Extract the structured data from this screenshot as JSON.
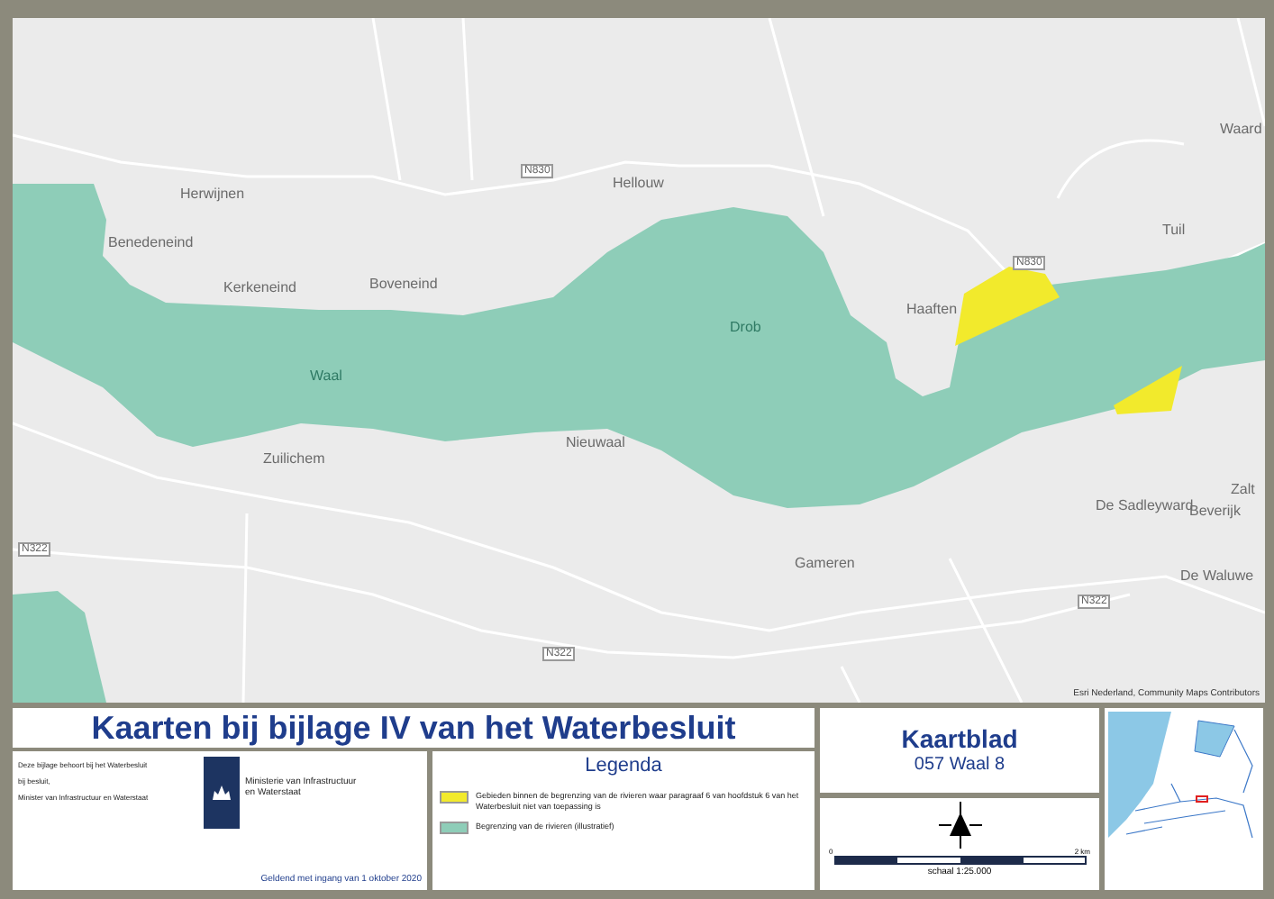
{
  "map": {
    "labels": [
      {
        "text": "Herwijnen",
        "kind": "place"
      },
      {
        "text": "Benedeneind",
        "kind": "place"
      },
      {
        "text": "Kerkeneind",
        "kind": "place"
      },
      {
        "text": "Boveneind",
        "kind": "place"
      },
      {
        "text": "N830",
        "kind": "road"
      },
      {
        "text": "Hellouw",
        "kind": "place"
      },
      {
        "text": "Waal",
        "kind": "water"
      },
      {
        "text": "Nieuwaal",
        "kind": "place"
      },
      {
        "text": "Zuilichem",
        "kind": "place"
      },
      {
        "text": "N322",
        "kind": "road"
      },
      {
        "text": "N322",
        "kind": "road"
      },
      {
        "text": "Drob",
        "kind": "water"
      },
      {
        "text": "Haaften",
        "kind": "place"
      },
      {
        "text": "N830",
        "kind": "road"
      },
      {
        "text": "Tuil",
        "kind": "place"
      },
      {
        "text": "Waard",
        "kind": "place"
      },
      {
        "text": "Gameren",
        "kind": "place"
      },
      {
        "text": "De Sadleyward",
        "kind": "place"
      },
      {
        "text": "Beverijk",
        "kind": "place"
      },
      {
        "text": "Zalt",
        "kind": "place"
      },
      {
        "text": "De Waluwe",
        "kind": "place"
      },
      {
        "text": "N322",
        "kind": "road"
      }
    ],
    "attribution": "Esri Nederland, Community Maps Contributors"
  },
  "title": "Kaarten bij bijlage IV van het Waterbesluit",
  "info": {
    "lines": [
      "Deze bijlage behoort bij het Waterbesluit",
      "bij besluit,",
      "Minister van Infrastructuur en Waterstaat"
    ],
    "ministry": [
      "Ministerie van Infrastructuur",
      "en Waterstaat"
    ],
    "valid_from": "Geldend met ingang van 1 oktober 2020"
  },
  "legend": {
    "title": "Legenda",
    "items": [
      {
        "label": "Gebieden binnen de begrenzing van de rivieren waar paragraaf 6 van hoofdstuk 6 van het Waterbesluit niet van toepassing is",
        "color": "#f2ea2c"
      },
      {
        "label": "Begrenzing van de rivieren (illustratief)",
        "color": "#8ecdb8"
      }
    ]
  },
  "sheet": {
    "title": "Kaartblad",
    "name": "057 Waal 8"
  },
  "scale": {
    "start": "0",
    "end": "2 km",
    "label": "schaal 1:25.000"
  }
}
